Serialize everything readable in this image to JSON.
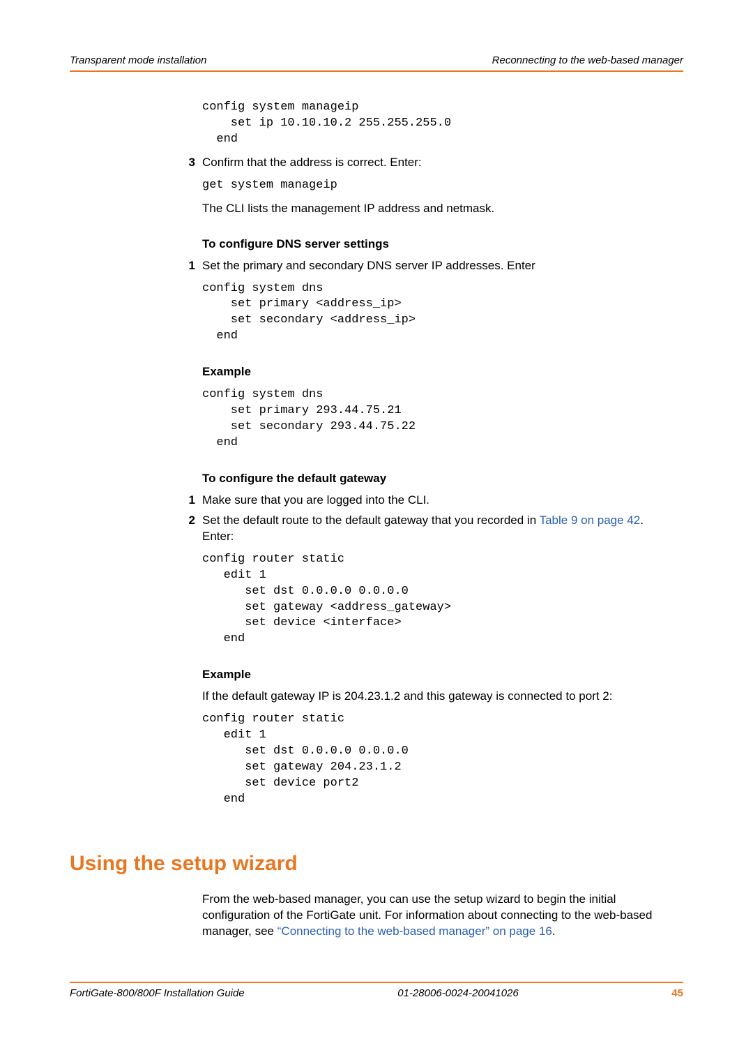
{
  "head": {
    "left": "Transparent mode installation",
    "right": "Reconnecting to the web-based manager"
  },
  "code1": "config system manageip\n    set ip 10.10.10.2 255.255.255.0\n  end",
  "step3_num": "3",
  "step3_text": "Confirm that the address is correct. Enter:",
  "code2": "get system manageip",
  "para1": "The CLI lists the management IP address and netmask.",
  "sub1": "To configure DNS server settings",
  "dns_step1_num": "1",
  "dns_step1_text": "Set the primary and secondary DNS server IP addresses. Enter",
  "code3": "config system dns\n    set primary <address_ip>\n    set secondary <address_ip>\n  end",
  "sub2": "Example",
  "code4": "config system dns\n    set primary 293.44.75.21\n    set secondary 293.44.75.22\n  end",
  "sub3": "To configure the default gateway",
  "gw_step1_num": "1",
  "gw_step1_text": "Make sure that you are logged into the CLI.",
  "gw_step2_num": "2",
  "gw_step2_pre": "Set the default route to the default gateway that you recorded in ",
  "gw_step2_link": "Table 9 on page 42",
  "gw_step2_post": ". Enter:",
  "code5": "config router static\n   edit 1\n      set dst 0.0.0.0 0.0.0.0\n      set gateway <address_gateway>\n      set device <interface>\n   end",
  "sub4": "Example",
  "para2": "If the default gateway IP is 204.23.1.2 and this gateway is connected to port 2:",
  "code6": "config router static\n   edit 1\n      set dst 0.0.0.0 0.0.0.0\n      set gateway 204.23.1.2\n      set device port2\n   end",
  "h2": "Using the setup wizard",
  "para3_pre": "From the web-based manager, you can use the setup wizard to begin the initial configuration of the FortiGate unit. For information about connecting to the web-based manager, see ",
  "para3_link": "“Connecting to the web-based manager” on page 16",
  "para3_post": ".",
  "footer": {
    "left": "FortiGate-800/800F Installation Guide",
    "mid": "01-28006-0024-20041026",
    "page": "45"
  }
}
